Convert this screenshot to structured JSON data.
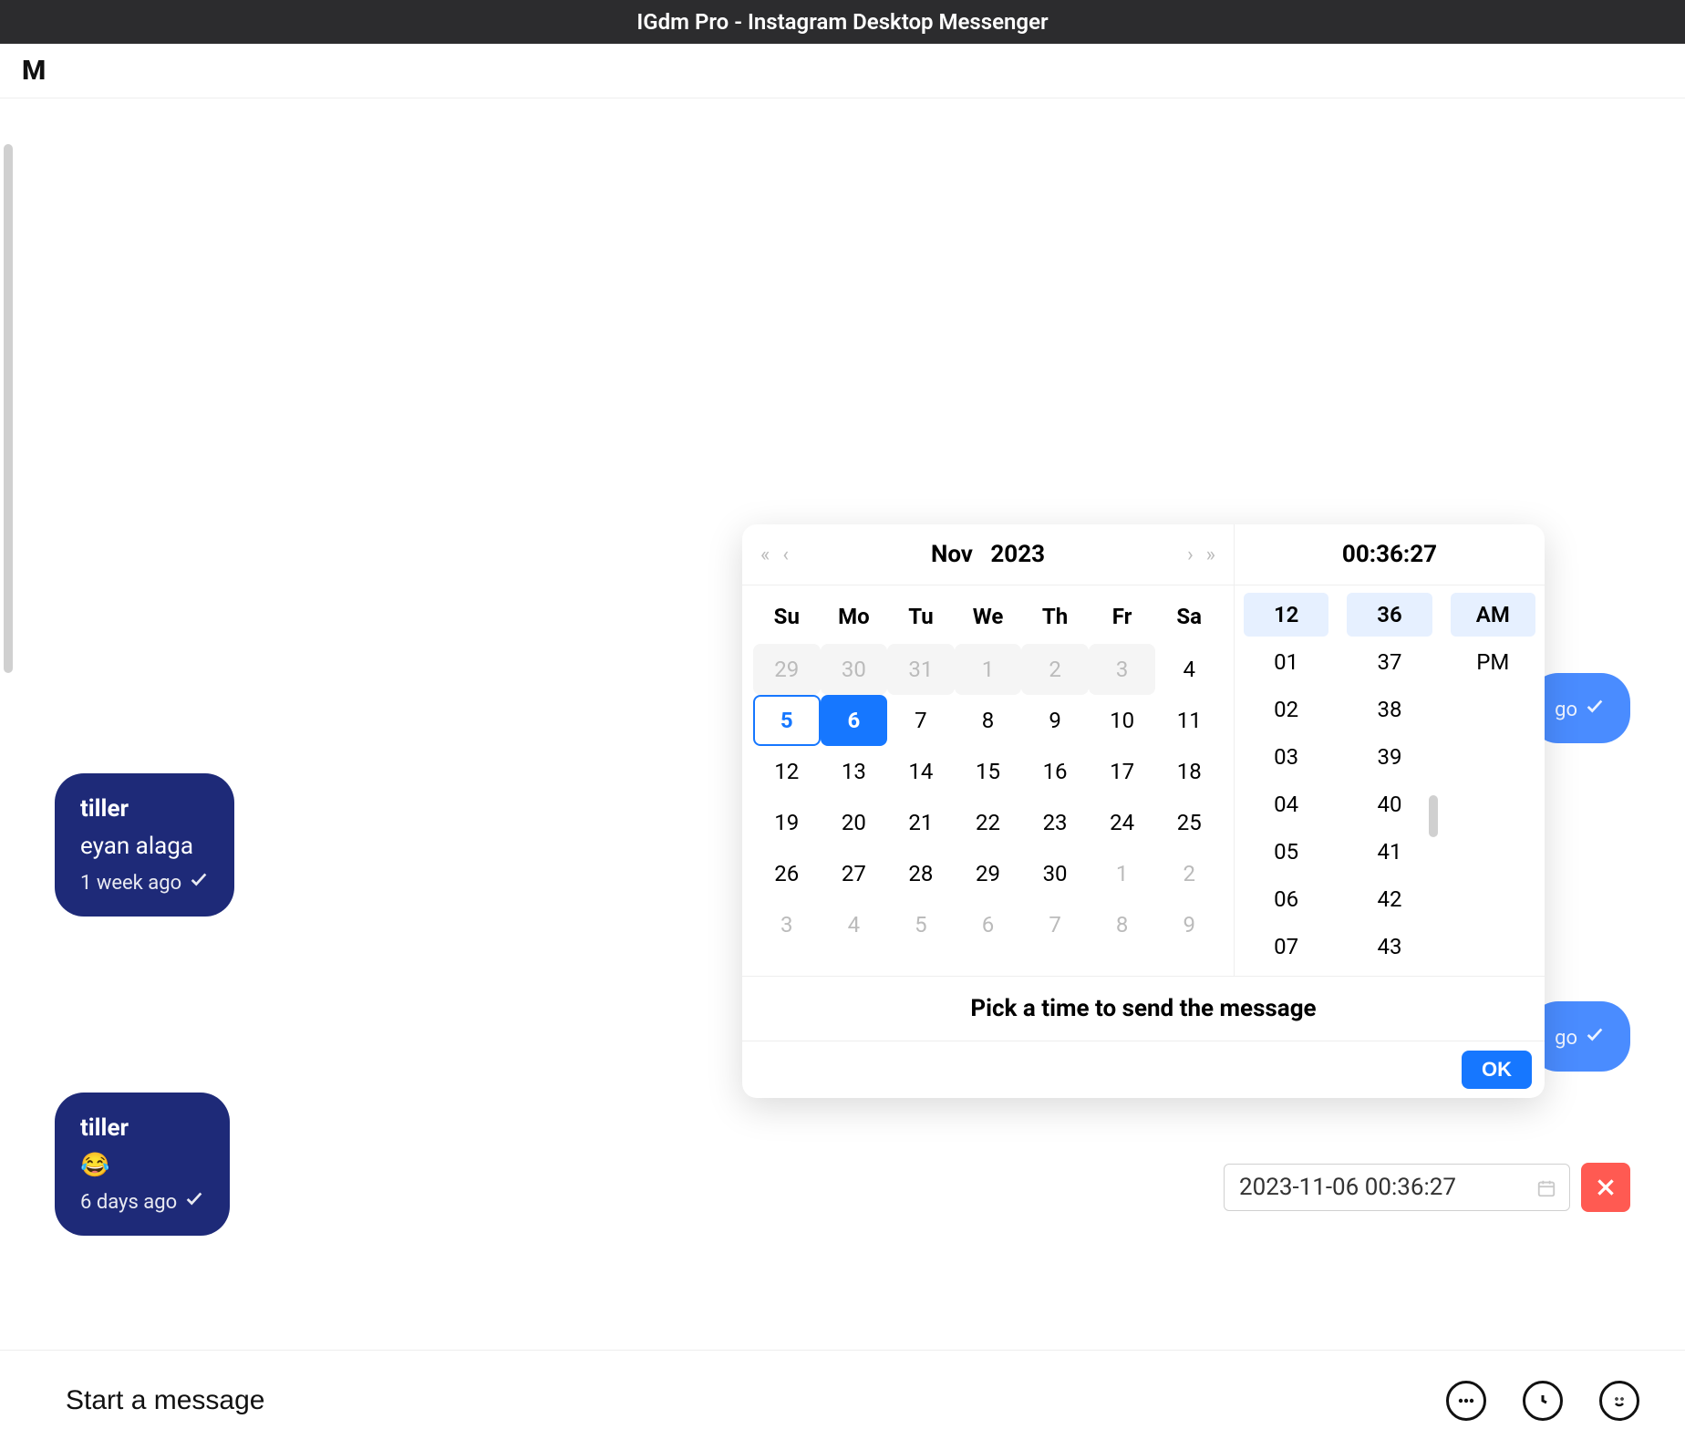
{
  "title": "IGdm Pro - Instagram Desktop Messenger",
  "header_avatar_initial": "M",
  "messages": {
    "sent_a_time": "go",
    "received_a_sender": "tiller",
    "received_a_text": "eyan alaga",
    "received_a_time": "1 week ago",
    "sent_b_time": "go",
    "received_b_sender": "tiller",
    "received_b_emoji": "😂",
    "received_b_time": "6 days ago"
  },
  "composer": {
    "placeholder": "Start a message"
  },
  "schedule_input": "2023-11-06 00:36:27",
  "datepicker": {
    "month_label": "Nov",
    "year_label": "2023",
    "time_label": "00:36:27",
    "weekdays": [
      "Su",
      "Mo",
      "Tu",
      "We",
      "Th",
      "Fr",
      "Sa"
    ],
    "week1": [
      "29",
      "30",
      "31",
      "1",
      "2",
      "3",
      "4"
    ],
    "week2": [
      "5",
      "6",
      "7",
      "8",
      "9",
      "10",
      "11"
    ],
    "week3": [
      "12",
      "13",
      "14",
      "15",
      "16",
      "17",
      "18"
    ],
    "week4": [
      "19",
      "20",
      "21",
      "22",
      "23",
      "24",
      "25"
    ],
    "week5": [
      "26",
      "27",
      "28",
      "29",
      "30",
      "1",
      "2"
    ],
    "week6": [
      "3",
      "4",
      "5",
      "6",
      "7",
      "8",
      "9"
    ],
    "hours": [
      "12",
      "01",
      "02",
      "03",
      "04",
      "05",
      "06",
      "07"
    ],
    "minutes": [
      "36",
      "37",
      "38",
      "39",
      "40",
      "41",
      "42",
      "43"
    ],
    "ampm": [
      "AM",
      "PM"
    ],
    "hint": "Pick a time to send the message",
    "ok_label": "OK"
  }
}
